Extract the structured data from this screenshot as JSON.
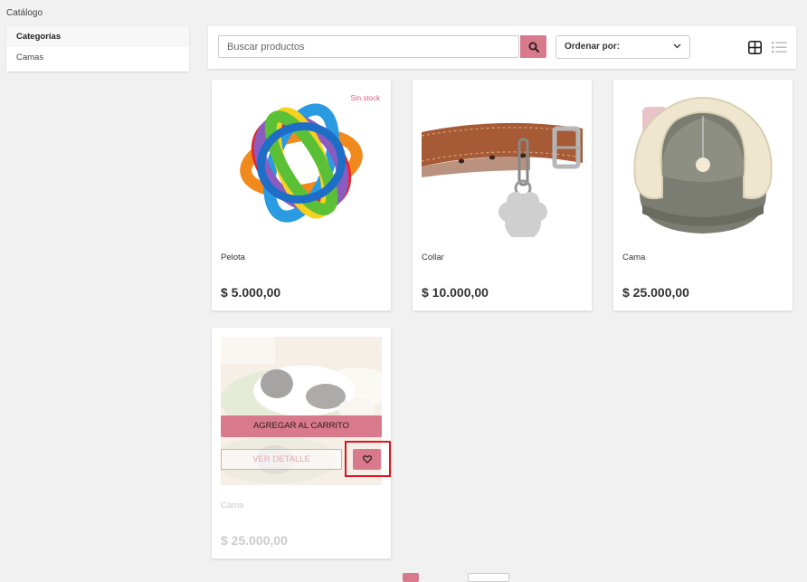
{
  "breadcrumb": "Catálogo",
  "sidebar": {
    "heading": "Categorías",
    "items": [
      {
        "label": "Camas"
      }
    ]
  },
  "toolbar": {
    "search_placeholder": "Buscar productos",
    "sort_label": "Ordenar por:"
  },
  "products": [
    {
      "name": "Pelota",
      "price": "$ 5.000,00",
      "badge": "Sin stock"
    },
    {
      "name": "Collar",
      "price": "$ 10.000,00"
    },
    {
      "name": "Cama",
      "price": "$ 25.000,00"
    },
    {
      "name": "Cama",
      "price": "$ 25.000,00"
    }
  ],
  "hover_actions": {
    "add_to_cart": "AGREGAR AL CARRITO",
    "view_detail": "VER DETALLE"
  },
  "colors": {
    "accent": "#d9798c",
    "highlight": "#e0141f",
    "badge": "#e05a72"
  },
  "icons": [
    "search-icon",
    "chevron-down-icon",
    "grid-view-icon",
    "list-view-icon",
    "heart-icon"
  ]
}
